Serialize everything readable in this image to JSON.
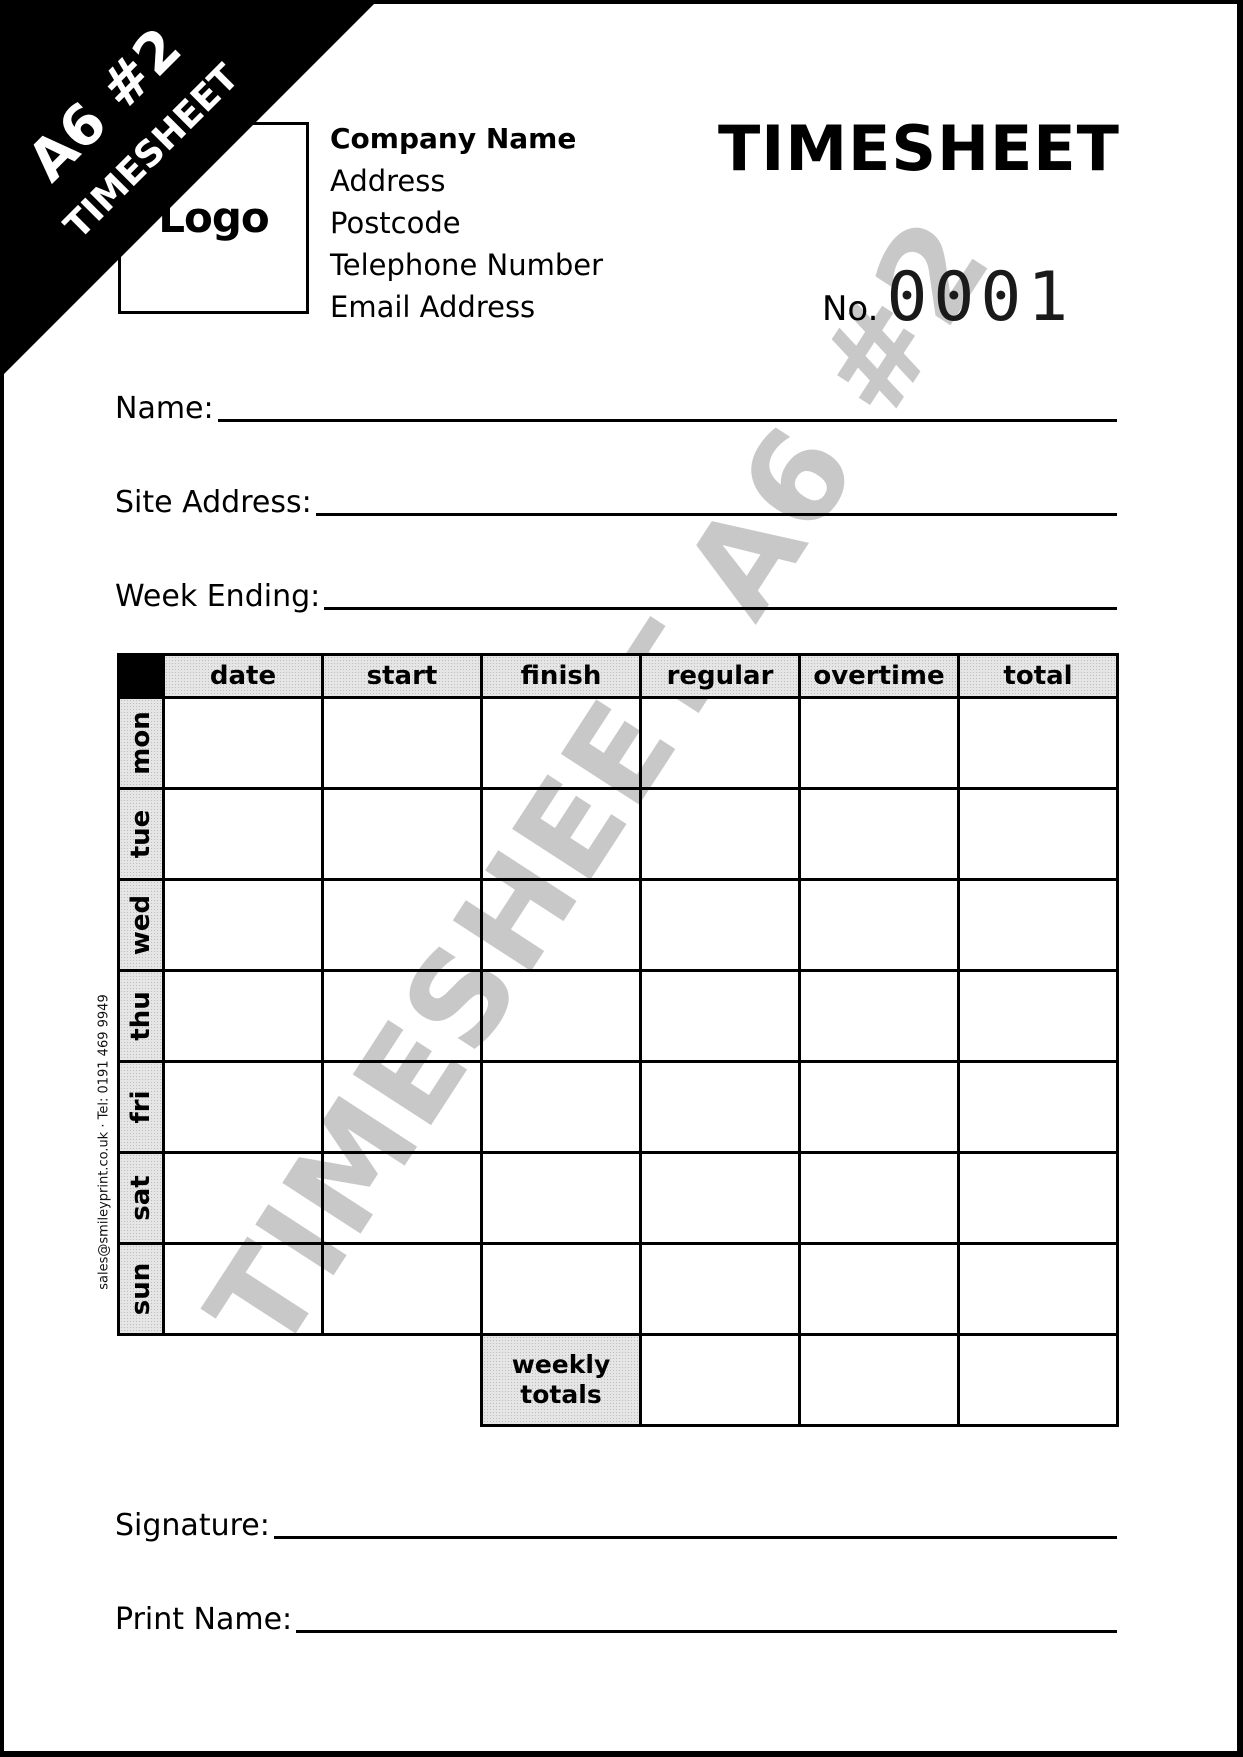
{
  "corner_ribbon": {
    "line1": "A6 #2",
    "line2": "TIMESHEET"
  },
  "watermark": "TIMESHEET A6 #2",
  "logo": {
    "label": "Logo"
  },
  "company": {
    "name": "Company Name",
    "address": "Address",
    "postcode": "Postcode",
    "telephone": "Telephone Number",
    "email": "Email Address"
  },
  "title": "TIMESHEET",
  "number": {
    "label": "No.",
    "value": "0001"
  },
  "fields": {
    "name": "Name:",
    "site_address": "Site Address:",
    "week_ending": "Week Ending:",
    "signature": "Signature:",
    "print_name": "Print Name:"
  },
  "table": {
    "columns": [
      "date",
      "start",
      "finish",
      "regular",
      "overtime",
      "total"
    ],
    "days": [
      "mon",
      "tue",
      "wed",
      "thu",
      "fri",
      "sat",
      "sun"
    ],
    "totals_label_line1": "weekly",
    "totals_label_line2": "totals"
  },
  "side_text": "sales@smileyprint.co.uk  ·  Tel: 0191 469 9949",
  "colors": {
    "ink": "#000000",
    "watermark": "#c6c6c6",
    "header_shade": "#e6e6e6"
  }
}
